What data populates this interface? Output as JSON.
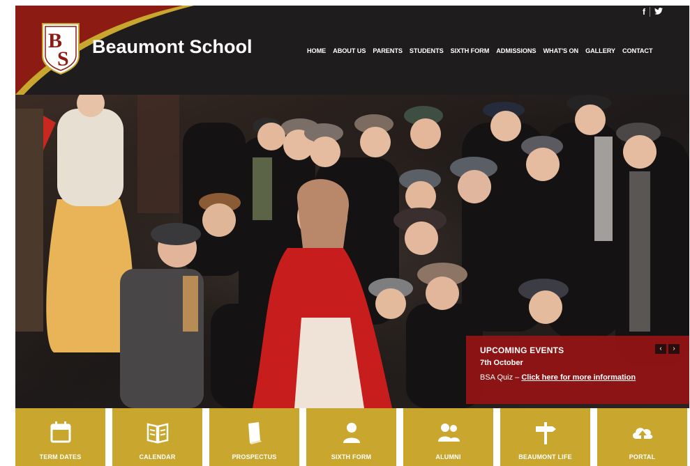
{
  "header": {
    "logo_letters": "BS",
    "school_name": "Beaumont School",
    "social": [
      "f",
      "🐦"
    ],
    "nav": [
      "HOME",
      "ABOUT US",
      "PARENTS",
      "STUDENTS",
      "SIXTH FORM",
      "ADMISSIONS",
      "WHAT'S ON",
      "GALLERY",
      "CONTACT"
    ]
  },
  "events": {
    "title": "UPCOMING EVENTS",
    "date": "7th October",
    "info_prefix": "BSA Quiz – ",
    "info_link": "Click here for more information",
    "prev": "‹",
    "next": "›"
  },
  "tiles": [
    {
      "label": "TERM DATES",
      "icon": "calendar-icon"
    },
    {
      "label": "CALENDAR",
      "icon": "book-open-icon"
    },
    {
      "label": "PROSPECTUS",
      "icon": "book-icon"
    },
    {
      "label": "SIXTH FORM",
      "icon": "person-icon"
    },
    {
      "label": "ALUMNI",
      "icon": "people-icon"
    },
    {
      "label": "BEAUMONT LIFE",
      "icon": "signpost-icon"
    },
    {
      "label": "PORTAL",
      "icon": "cloud-upload-icon"
    }
  ],
  "colors": {
    "header_bg": "#1e1c1d",
    "brand_red": "#8c1c13",
    "brand_gold": "#c9a72e",
    "events_red": "#961414"
  }
}
